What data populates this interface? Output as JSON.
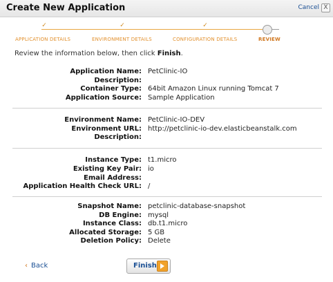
{
  "window": {
    "title": "Create New Application",
    "cancel_label": "Cancel",
    "close_glyph": "X"
  },
  "wizard": {
    "steps": [
      {
        "label": "APPLICATION DETAILS",
        "state": "done"
      },
      {
        "label": "ENVIRONMENT DETAILS",
        "state": "done"
      },
      {
        "label": "CONFIGURATION DETAILS",
        "state": "done"
      },
      {
        "label": "REVIEW",
        "state": "current"
      }
    ],
    "check_glyph": "✓"
  },
  "intro": {
    "text": "Review the information below, then click ",
    "emphasis": "Finish",
    "end": "."
  },
  "application": {
    "name_label": "Application Name:",
    "name": "PetClinic-IO",
    "description_label": "Description:",
    "description": "",
    "container_label": "Container Type:",
    "container": "64bit Amazon Linux running Tomcat 7",
    "source_label": "Application Source:",
    "source": "Sample Application"
  },
  "environment": {
    "name_label": "Environment Name:",
    "name": "PetClinic-IO-DEV",
    "url_label": "Environment URL:",
    "url": "http://petclinic-io-dev.elasticbeanstalk.com",
    "description_label": "Description:",
    "description": ""
  },
  "configuration": {
    "instance_type_label": "Instance Type:",
    "instance_type": "t1.micro",
    "key_pair_label": "Existing Key Pair:",
    "key_pair": "io",
    "email_label": "Email Address:",
    "email": "",
    "health_check_label": "Application Health Check URL:",
    "health_check": "/"
  },
  "database": {
    "snapshot_label": "Snapshot Name:",
    "snapshot": "petclinic-database-snapshot",
    "engine_label": "DB Engine:",
    "engine": "mysql",
    "class_label": "Instance Class:",
    "class": "db.t1.micro",
    "storage_label": "Allocated Storage:",
    "storage": "5 GB",
    "deletion_label": "Deletion Policy:",
    "deletion": "Delete"
  },
  "footer": {
    "back_glyph": "‹",
    "back_label": "Back",
    "finish_label": "Finish"
  },
  "colors": {
    "accent_orange": "#e28f2b",
    "link_blue": "#1a4f94"
  }
}
